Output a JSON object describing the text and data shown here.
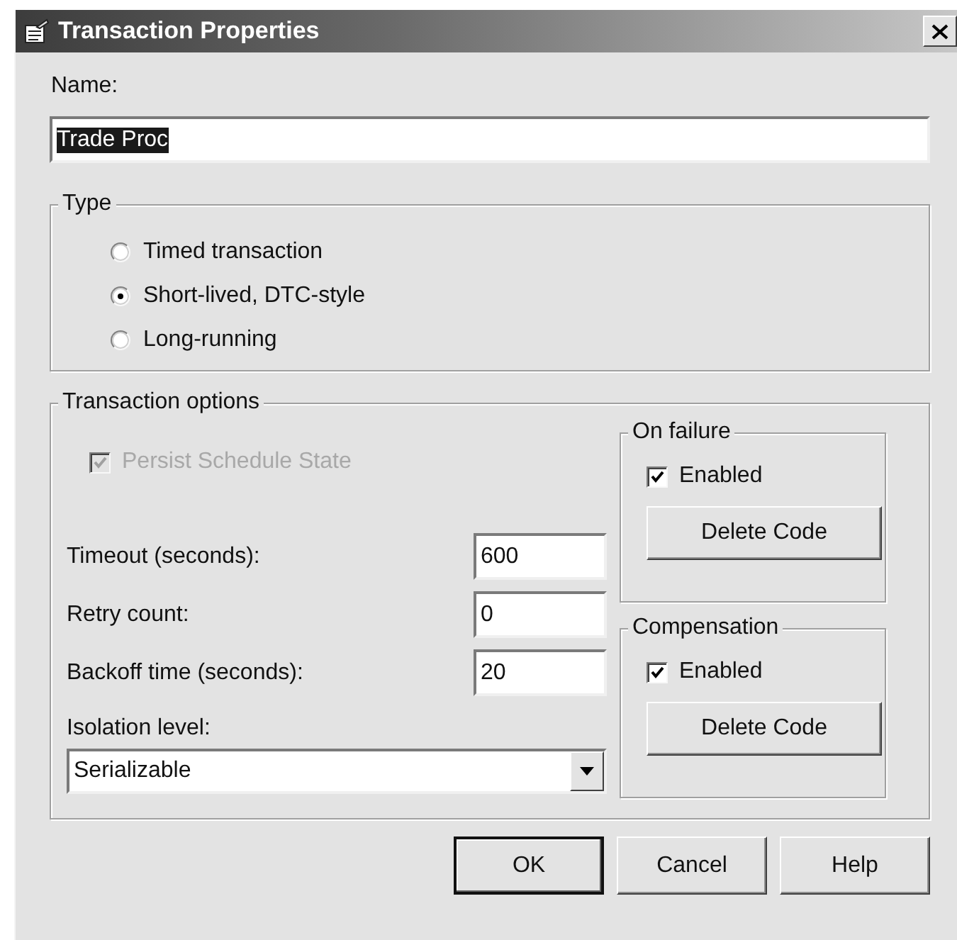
{
  "window": {
    "title": "Transaction Properties"
  },
  "name_field": {
    "label": "Name:",
    "value": "Trade Proc",
    "text_selected": true
  },
  "type_group": {
    "title": "Type",
    "options": [
      {
        "label": "Timed transaction",
        "selected": false
      },
      {
        "label": "Short-lived, DTC-style",
        "selected": true
      },
      {
        "label": "Long-running",
        "selected": false
      }
    ]
  },
  "transaction_options": {
    "title": "Transaction options",
    "persist": {
      "label": "Persist Schedule State",
      "checked": true,
      "disabled": true
    },
    "fields": [
      {
        "label": "Timeout (seconds):",
        "value": "600"
      },
      {
        "label": "Retry count:",
        "value": "0"
      },
      {
        "label": "Backoff time (seconds):",
        "value": "20"
      }
    ],
    "isolation": {
      "label": "Isolation level:",
      "value": "Serializable"
    },
    "side_groups": [
      {
        "title": "On failure",
        "checkbox": {
          "label": "Enabled",
          "checked": true,
          "disabled": false
        },
        "button": "Delete Code"
      },
      {
        "title": "Compensation",
        "checkbox": {
          "label": "Enabled",
          "checked": true,
          "disabled": false
        },
        "button": "Delete Code"
      }
    ]
  },
  "buttons": [
    {
      "label": "OK",
      "default": true
    },
    {
      "label": "Cancel",
      "default": false
    },
    {
      "label": "Help",
      "default": false
    }
  ]
}
